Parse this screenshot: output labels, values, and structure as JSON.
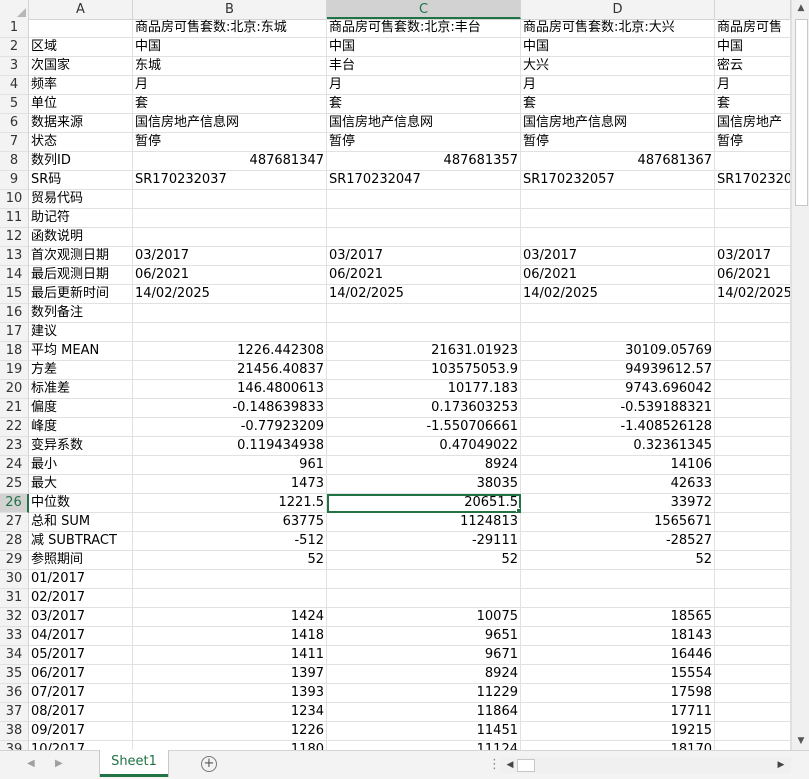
{
  "columns": [
    "A",
    "B",
    "C",
    "D"
  ],
  "selected_column": "C",
  "selected_row": "26",
  "active_cell": "C26",
  "rows": [
    {
      "n": "1",
      "a": "",
      "b": "商品房可售套数:北京:东城",
      "c": "商品房可售套数:北京:丰台",
      "d": "商品房可售套数:北京:大兴",
      "e": "商品房可售",
      "num": false
    },
    {
      "n": "2",
      "a": "区域",
      "b": "中国",
      "c": "中国",
      "d": "中国",
      "e": "中国",
      "num": false
    },
    {
      "n": "3",
      "a": "次国家",
      "b": "东城",
      "c": "丰台",
      "d": "大兴",
      "e": "密云",
      "num": false
    },
    {
      "n": "4",
      "a": "频率",
      "b": "月",
      "c": "月",
      "d": "月",
      "e": "月",
      "num": false
    },
    {
      "n": "5",
      "a": "单位",
      "b": "套",
      "c": "套",
      "d": "套",
      "e": "套",
      "num": false
    },
    {
      "n": "6",
      "a": "数据来源",
      "b": "国信房地产信息网",
      "c": "国信房地产信息网",
      "d": "国信房地产信息网",
      "e": "国信房地产",
      "num": false
    },
    {
      "n": "7",
      "a": "状态",
      "b": "暂停",
      "c": "暂停",
      "d": "暂停",
      "e": "暂停",
      "num": false
    },
    {
      "n": "8",
      "a": "数列ID",
      "b": "487681347",
      "c": "487681357",
      "d": "487681367",
      "e": "",
      "num": true
    },
    {
      "n": "9",
      "a": "SR码",
      "b": "SR170232037",
      "c": "SR170232047",
      "d": "SR170232057",
      "e": "SR1702320",
      "num": false
    },
    {
      "n": "10",
      "a": "贸易代码",
      "b": "",
      "c": "",
      "d": "",
      "e": "",
      "num": false
    },
    {
      "n": "11",
      "a": "助记符",
      "b": "",
      "c": "",
      "d": "",
      "e": "",
      "num": false
    },
    {
      "n": "12",
      "a": "函数说明",
      "b": "",
      "c": "",
      "d": "",
      "e": "",
      "num": false
    },
    {
      "n": "13",
      "a": "首次观测日期",
      "b": "03/2017",
      "c": "03/2017",
      "d": "03/2017",
      "e": "03/2017",
      "num": false
    },
    {
      "n": "14",
      "a": "最后观测日期",
      "b": "06/2021",
      "c": "06/2021",
      "d": "06/2021",
      "e": "06/2021",
      "num": false
    },
    {
      "n": "15",
      "a": "最后更新时间",
      "b": "14/02/2025",
      "c": "14/02/2025",
      "d": "14/02/2025",
      "e": "14/02/2025",
      "num": false
    },
    {
      "n": "16",
      "a": "数列备注",
      "b": "",
      "c": "",
      "d": "",
      "e": "",
      "num": false
    },
    {
      "n": "17",
      "a": "建议",
      "b": "",
      "c": "",
      "d": "",
      "e": "",
      "num": false
    },
    {
      "n": "18",
      "a": "平均 MEAN",
      "b": "1226.442308",
      "c": "21631.01923",
      "d": "30109.05769",
      "e": "",
      "num": true
    },
    {
      "n": "19",
      "a": "方差",
      "b": "21456.40837",
      "c": "103575053.9",
      "d": "94939612.57",
      "e": "",
      "num": true
    },
    {
      "n": "20",
      "a": "标准差",
      "b": "146.4800613",
      "c": "10177.183",
      "d": "9743.696042",
      "e": "",
      "num": true
    },
    {
      "n": "21",
      "a": "偏度",
      "b": "-0.148639833",
      "c": "0.173603253",
      "d": "-0.539188321",
      "e": "",
      "num": true
    },
    {
      "n": "22",
      "a": "峰度",
      "b": "-0.77923209",
      "c": "-1.550706661",
      "d": "-1.408526128",
      "e": "",
      "num": true
    },
    {
      "n": "23",
      "a": "变异系数",
      "b": "0.119434938",
      "c": "0.47049022",
      "d": "0.32361345",
      "e": "",
      "num": true
    },
    {
      "n": "24",
      "a": "最小",
      "b": "961",
      "c": "8924",
      "d": "14106",
      "e": "",
      "num": true
    },
    {
      "n": "25",
      "a": "最大",
      "b": "1473",
      "c": "38035",
      "d": "42633",
      "e": "",
      "num": true
    },
    {
      "n": "26",
      "a": "中位数",
      "b": "1221.5",
      "c": "20651.5",
      "d": "33972",
      "e": "",
      "num": true
    },
    {
      "n": "27",
      "a": "总和 SUM",
      "b": "63775",
      "c": "1124813",
      "d": "1565671",
      "e": "",
      "num": true
    },
    {
      "n": "28",
      "a": "减 SUBTRACT",
      "b": "-512",
      "c": "-29111",
      "d": "-28527",
      "e": "",
      "num": true
    },
    {
      "n": "29",
      "a": "参照期间",
      "b": "52",
      "c": "52",
      "d": "52",
      "e": "",
      "num": true
    },
    {
      "n": "30",
      "a": "01/2017",
      "b": "",
      "c": "",
      "d": "",
      "e": "",
      "num": true
    },
    {
      "n": "31",
      "a": "02/2017",
      "b": "",
      "c": "",
      "d": "",
      "e": "",
      "num": true
    },
    {
      "n": "32",
      "a": "03/2017",
      "b": "1424",
      "c": "10075",
      "d": "18565",
      "e": "",
      "num": true
    },
    {
      "n": "33",
      "a": "04/2017",
      "b": "1418",
      "c": "9651",
      "d": "18143",
      "e": "",
      "num": true
    },
    {
      "n": "34",
      "a": "05/2017",
      "b": "1411",
      "c": "9671",
      "d": "16446",
      "e": "",
      "num": true
    },
    {
      "n": "35",
      "a": "06/2017",
      "b": "1397",
      "c": "8924",
      "d": "15554",
      "e": "",
      "num": true
    },
    {
      "n": "36",
      "a": "07/2017",
      "b": "1393",
      "c": "11229",
      "d": "17598",
      "e": "",
      "num": true
    },
    {
      "n": "37",
      "a": "08/2017",
      "b": "1234",
      "c": "11864",
      "d": "17711",
      "e": "",
      "num": true
    },
    {
      "n": "38",
      "a": "09/2017",
      "b": "1226",
      "c": "11451",
      "d": "19215",
      "e": "",
      "num": true
    },
    {
      "n": "39",
      "a": "10/2017",
      "b": "1180",
      "c": "11124",
      "d": "18170",
      "e": "",
      "num": true
    }
  ],
  "sheet_tab": "Sheet1",
  "add_sheet_label": "+",
  "icons": {
    "scroll_up": "triangle-up-icon",
    "scroll_down": "triangle-down-icon",
    "scroll_left": "triangle-left-icon",
    "scroll_right": "triangle-right-icon",
    "add_sheet": "plus-circle-icon"
  },
  "colors": {
    "accent": "#217346",
    "header_bg": "#f3f3f3",
    "grid_line": "#e1e1e1"
  }
}
